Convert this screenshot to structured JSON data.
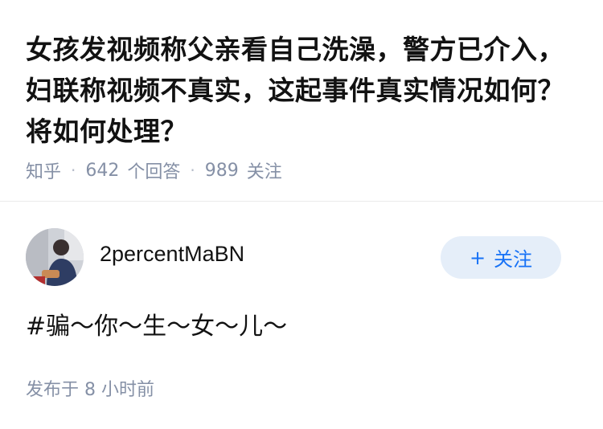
{
  "question": {
    "title": "女孩发视频称父亲看自己洗澡，警方已介入，妇联称视频不真实，这起事件真实情况如何？将如何处理？",
    "source": "知乎",
    "answer_count": "642",
    "answer_label": "个回答",
    "follow_count": "989",
    "follow_label": "关注"
  },
  "answer": {
    "author_name": "2percentMaBN",
    "follow_button": {
      "icon": "plus-icon",
      "plus": "+",
      "label": "关注"
    },
    "content": "#骗～你～生～女～儿～",
    "publish_time": "发布于  8 小时前"
  },
  "colors": {
    "title": "#121212",
    "meta": "#8590a6",
    "follow_bg": "#e5eef9",
    "follow_text": "#1772f6",
    "divider": "#ebebeb"
  }
}
